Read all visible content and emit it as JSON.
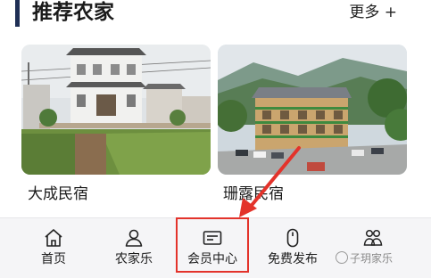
{
  "header": {
    "title": "推荐农家",
    "more_label": "更多 +"
  },
  "cards": [
    {
      "name": "大成民宿"
    },
    {
      "name": "珊露民宿"
    }
  ],
  "nav": {
    "items": [
      {
        "label": "首页",
        "icon": "home-icon"
      },
      {
        "label": "农家乐",
        "icon": "person-icon"
      },
      {
        "label": "会员中心",
        "icon": "member-card-icon"
      },
      {
        "label": "免费发布",
        "icon": "mouse-icon"
      },
      {
        "label": "",
        "icon": "group-icon"
      }
    ],
    "highlighted_index": 2
  },
  "annotation": {
    "arrow_color": "#e3332b",
    "highlight_color": "#e3332b"
  },
  "watermark": {
    "text": "子玥家乐"
  }
}
